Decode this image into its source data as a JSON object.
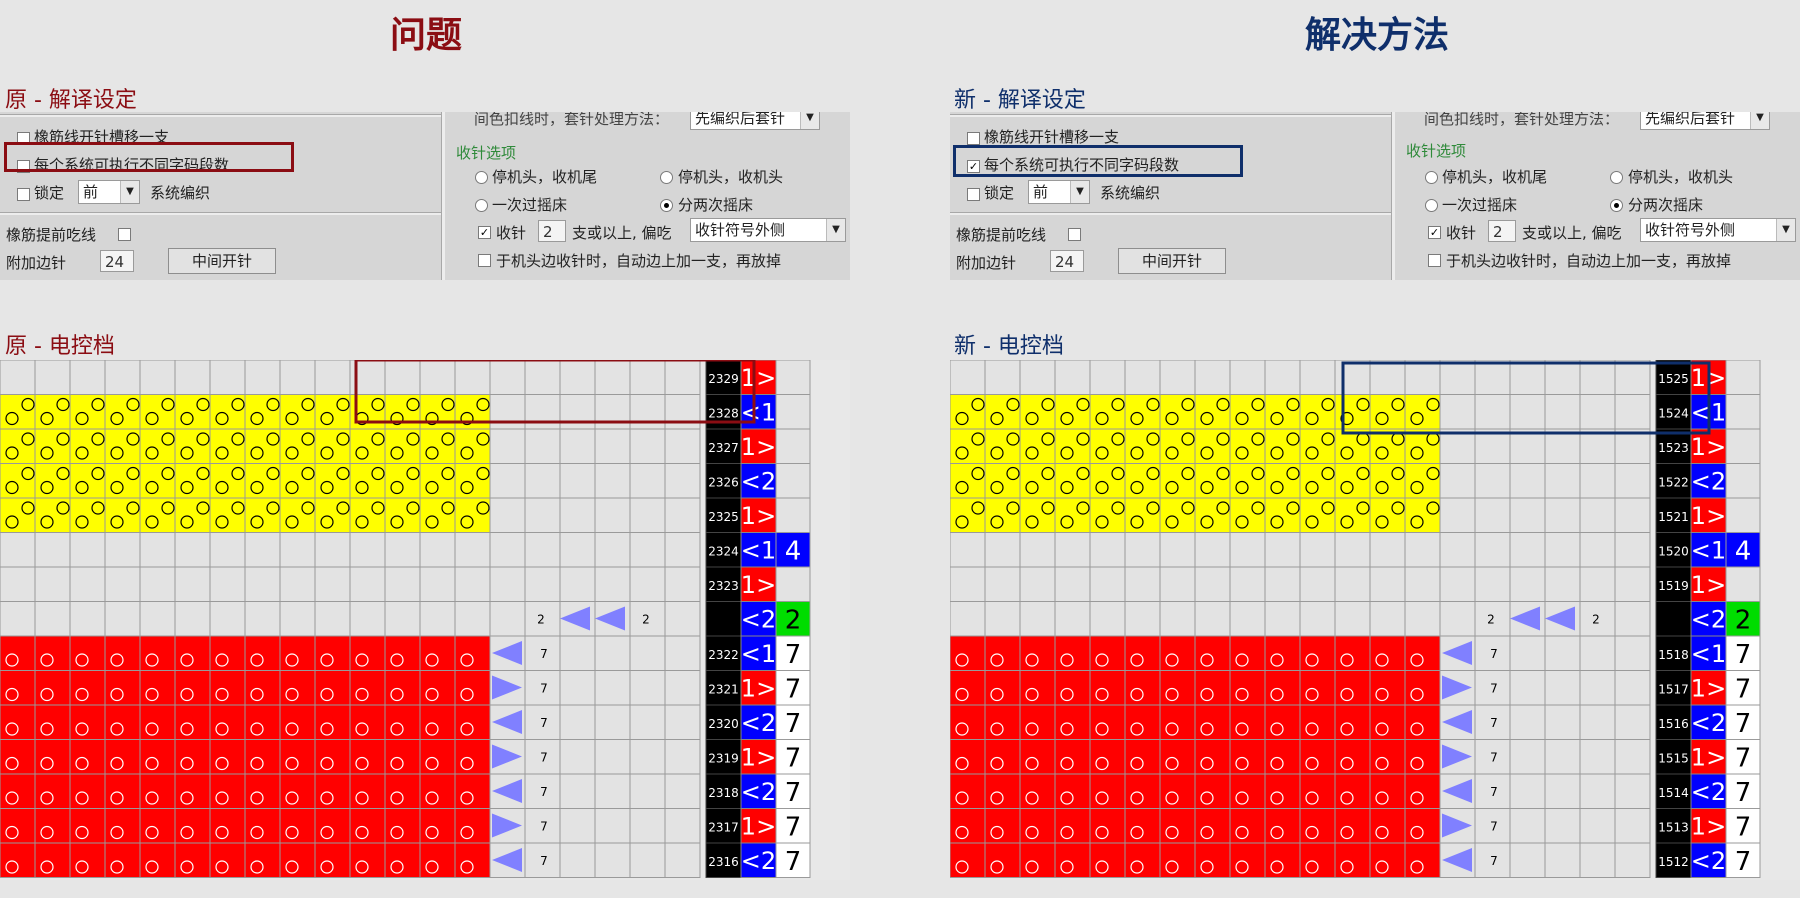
{
  "left": {
    "headline": "问题",
    "settings_title": "原 - 解译设定",
    "panel": {
      "opt1": "橡筋线开针槽移一支",
      "opt2": "每个系统可执行不同字码段数",
      "opt2_checked": false,
      "lock_label": "锁定",
      "lock_value": "前",
      "system_knit": "系统编织",
      "top_note": "间色扣线时，套针处理方法：",
      "top_value": "先编织后套针",
      "section": "收针选项",
      "r1a": "停机头，收机尾",
      "r1b": "停机头，收机头",
      "r2a": "一次过摇床",
      "r2b": "分两次摇床",
      "shou_label": "收针",
      "shou_value": "2",
      "shou_note": "支或以上, 偏吃",
      "shou_sel": "收针符号外侧",
      "rubber": "橡筋提前吃线",
      "extra_label": "附加边针",
      "extra_value": "24",
      "mid_btn": "中间开针",
      "bottom": "于机头边收针时，自动边上加一支，再放掉"
    },
    "grid_title": "原 - 电控档",
    "rows": [
      {
        "n": "2329",
        "a": "1>",
        "ac": "#ff0000",
        "b": "",
        "bc": "",
        "y": "",
        "r": ""
      },
      {
        "n": "2328",
        "a": "<1",
        "ac": "#0000ff",
        "b": "",
        "bc": "",
        "y": "y",
        "r": ""
      },
      {
        "n": "2327",
        "a": "1>",
        "ac": "#ff0000",
        "b": "",
        "bc": "",
        "y": "y",
        "r": ""
      },
      {
        "n": "2326",
        "a": "<2",
        "ac": "#0000ff",
        "b": "",
        "bc": "",
        "y": "y",
        "r": ""
      },
      {
        "n": "2325",
        "a": "1>",
        "ac": "#ff0000",
        "b": "",
        "bc": "",
        "y": "y",
        "r": ""
      },
      {
        "n": "2324",
        "a": "<1",
        "ac": "#0000ff",
        "b": "4",
        "bc": "#0000ff",
        "y": "",
        "r": ""
      },
      {
        "n": "2323",
        "a": "1>",
        "ac": "#ff0000",
        "b": "",
        "bc": "",
        "y": "",
        "r": ""
      },
      {
        "n": "",
        "a": "<2",
        "ac": "#0000ff",
        "b": "2",
        "bc": "#00dd00",
        "y": "",
        "r": "",
        "tri": "mid"
      },
      {
        "n": "2322",
        "a": "<1",
        "ac": "#0000ff",
        "b": "7",
        "bc": "#ffffff",
        "y": "",
        "r": "r",
        "tri": "L"
      },
      {
        "n": "2321",
        "a": "1>",
        "ac": "#ff0000",
        "b": "7",
        "bc": "#ffffff",
        "y": "",
        "r": "r",
        "tri": "R"
      },
      {
        "n": "2320",
        "a": "<2",
        "ac": "#0000ff",
        "b": "7",
        "bc": "#ffffff",
        "y": "",
        "r": "r",
        "tri": "L"
      },
      {
        "n": "2319",
        "a": "1>",
        "ac": "#ff0000",
        "b": "7",
        "bc": "#ffffff",
        "y": "",
        "r": "r",
        "tri": "R"
      },
      {
        "n": "2318",
        "a": "<2",
        "ac": "#0000ff",
        "b": "7",
        "bc": "#ffffff",
        "y": "",
        "r": "r",
        "tri": "L"
      },
      {
        "n": "2317",
        "a": "1>",
        "ac": "#ff0000",
        "b": "7",
        "bc": "#ffffff",
        "y": "",
        "r": "r",
        "tri": "R"
      },
      {
        "n": "2316",
        "a": "<2",
        "ac": "#0000ff",
        "b": "7",
        "bc": "#ffffff",
        "y": "",
        "r": "r",
        "tri": "L"
      }
    ],
    "mid_labels": [
      "2",
      "2"
    ],
    "tri_label": "7"
  },
  "right": {
    "headline": "解决方法",
    "settings_title": "新 - 解译设定",
    "panel": {
      "opt1": "橡筋线开针槽移一支",
      "opt2": "每个系统可执行不同字码段数",
      "opt2_checked": true,
      "lock_label": "锁定",
      "lock_value": "前",
      "system_knit": "系统编织",
      "top_note": "间色扣线时，套针处理方法：",
      "top_value": "先编织后套针",
      "section": "收针选项",
      "r1a": "停机头，收机尾",
      "r1b": "停机头，收机头",
      "r2a": "一次过摇床",
      "r2b": "分两次摇床",
      "shou_label": "收针",
      "shou_value": "2",
      "shou_note": "支或以上, 偏吃",
      "shou_sel": "收针符号外侧",
      "rubber": "橡筋提前吃线",
      "extra_label": "附加边针",
      "extra_value": "24",
      "mid_btn": "中间开针",
      "bottom": "于机头边收针时，自动边上加一支，再放掉"
    },
    "grid_title": "新 - 电控档",
    "rows": [
      {
        "n": "1525",
        "a": "1>",
        "ac": "#ff0000",
        "b": "",
        "bc": "",
        "y": "",
        "r": ""
      },
      {
        "n": "1524",
        "a": "<1",
        "ac": "#0000ff",
        "b": "",
        "bc": "",
        "y": "y",
        "r": ""
      },
      {
        "n": "1523",
        "a": "1>",
        "ac": "#ff0000",
        "b": "",
        "bc": "",
        "y": "y",
        "r": ""
      },
      {
        "n": "1522",
        "a": "<2",
        "ac": "#0000ff",
        "b": "",
        "bc": "",
        "y": "y",
        "r": ""
      },
      {
        "n": "1521",
        "a": "1>",
        "ac": "#ff0000",
        "b": "",
        "bc": "",
        "y": "y",
        "r": ""
      },
      {
        "n": "1520",
        "a": "<1",
        "ac": "#0000ff",
        "b": "4",
        "bc": "#0000ff",
        "y": "",
        "r": ""
      },
      {
        "n": "1519",
        "a": "1>",
        "ac": "#ff0000",
        "b": "",
        "bc": "",
        "y": "",
        "r": ""
      },
      {
        "n": "",
        "a": "<2",
        "ac": "#0000ff",
        "b": "2",
        "bc": "#00dd00",
        "y": "",
        "r": "",
        "tri": "mid"
      },
      {
        "n": "1518",
        "a": "<1",
        "ac": "#0000ff",
        "b": "7",
        "bc": "#ffffff",
        "y": "",
        "r": "r",
        "tri": "L"
      },
      {
        "n": "1517",
        "a": "1>",
        "ac": "#ff0000",
        "b": "7",
        "bc": "#ffffff",
        "y": "",
        "r": "r",
        "tri": "R"
      },
      {
        "n": "1516",
        "a": "<2",
        "ac": "#0000ff",
        "b": "7",
        "bc": "#ffffff",
        "y": "",
        "r": "r",
        "tri": "L"
      },
      {
        "n": "1515",
        "a": "1>",
        "ac": "#ff0000",
        "b": "7",
        "bc": "#ffffff",
        "y": "",
        "r": "r",
        "tri": "R"
      },
      {
        "n": "1514",
        "a": "<2",
        "ac": "#0000ff",
        "b": "7",
        "bc": "#ffffff",
        "y": "",
        "r": "r",
        "tri": "L"
      },
      {
        "n": "1513",
        "a": "1>",
        "ac": "#ff0000",
        "b": "7",
        "bc": "#ffffff",
        "y": "",
        "r": "r",
        "tri": "R"
      },
      {
        "n": "1512",
        "a": "<2",
        "ac": "#0000ff",
        "b": "7",
        "bc": "#ffffff",
        "y": "",
        "r": "r",
        "tri": "L"
      }
    ],
    "mid_labels": [
      "2",
      "2"
    ],
    "tri_label": "7"
  },
  "colors": {
    "problem": "#8b0d13",
    "solution": "#0f2f6b",
    "yellow": "#ffff00",
    "red": "#ff0000",
    "triangle": "#8080ff"
  }
}
